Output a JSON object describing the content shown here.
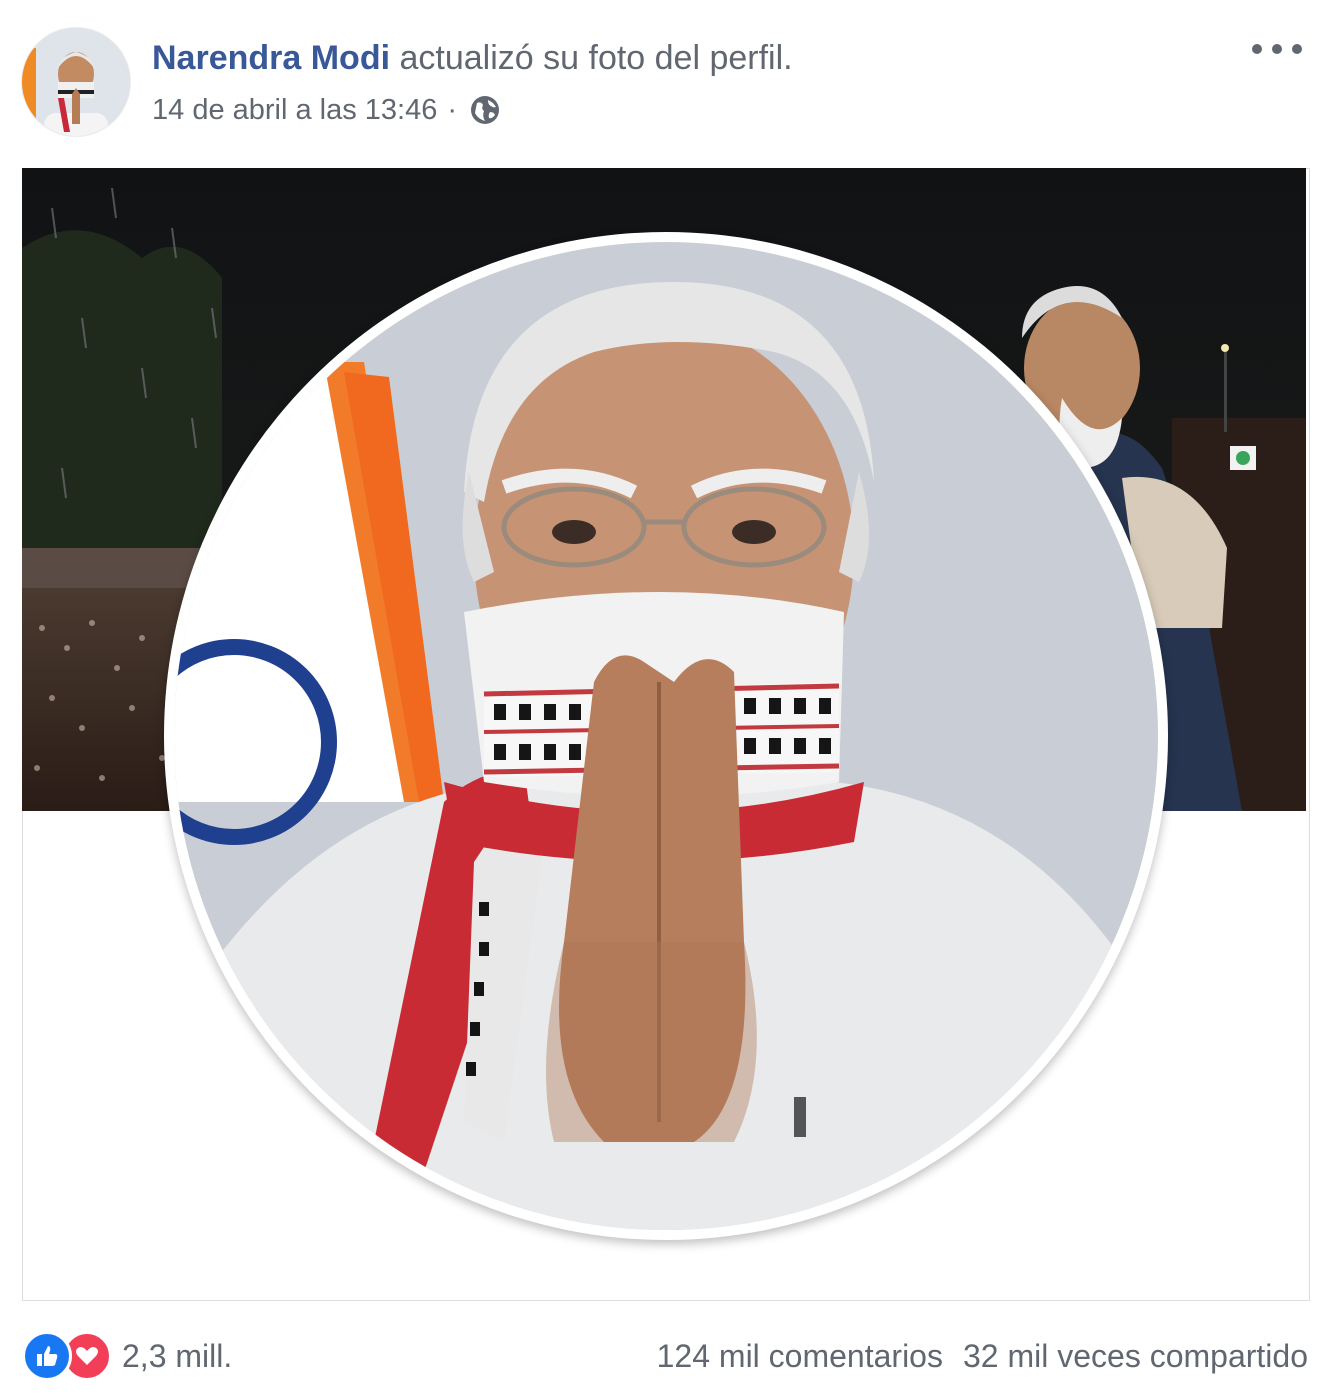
{
  "post": {
    "author": "Narendra Modi",
    "action": "actualizó su foto del perfil.",
    "timestamp": "14 de abril a las 13:46",
    "separator": "·",
    "privacy_icon": "globe-icon",
    "more_icon": "more-options-icon"
  },
  "photo": {
    "cover_description_icon": "cover-photo",
    "profile_description_icon": "profile-photo"
  },
  "footer": {
    "reactions_count": "2,3 mill.",
    "reaction_icons": [
      "like-icon",
      "love-icon"
    ],
    "comments": "124 mil comentarios",
    "shares": "32 mil veces compartido"
  },
  "colors": {
    "author_link": "#385898",
    "meta_text": "#616770",
    "like_blue": "#1877f2",
    "love_red": "#f33e58"
  }
}
